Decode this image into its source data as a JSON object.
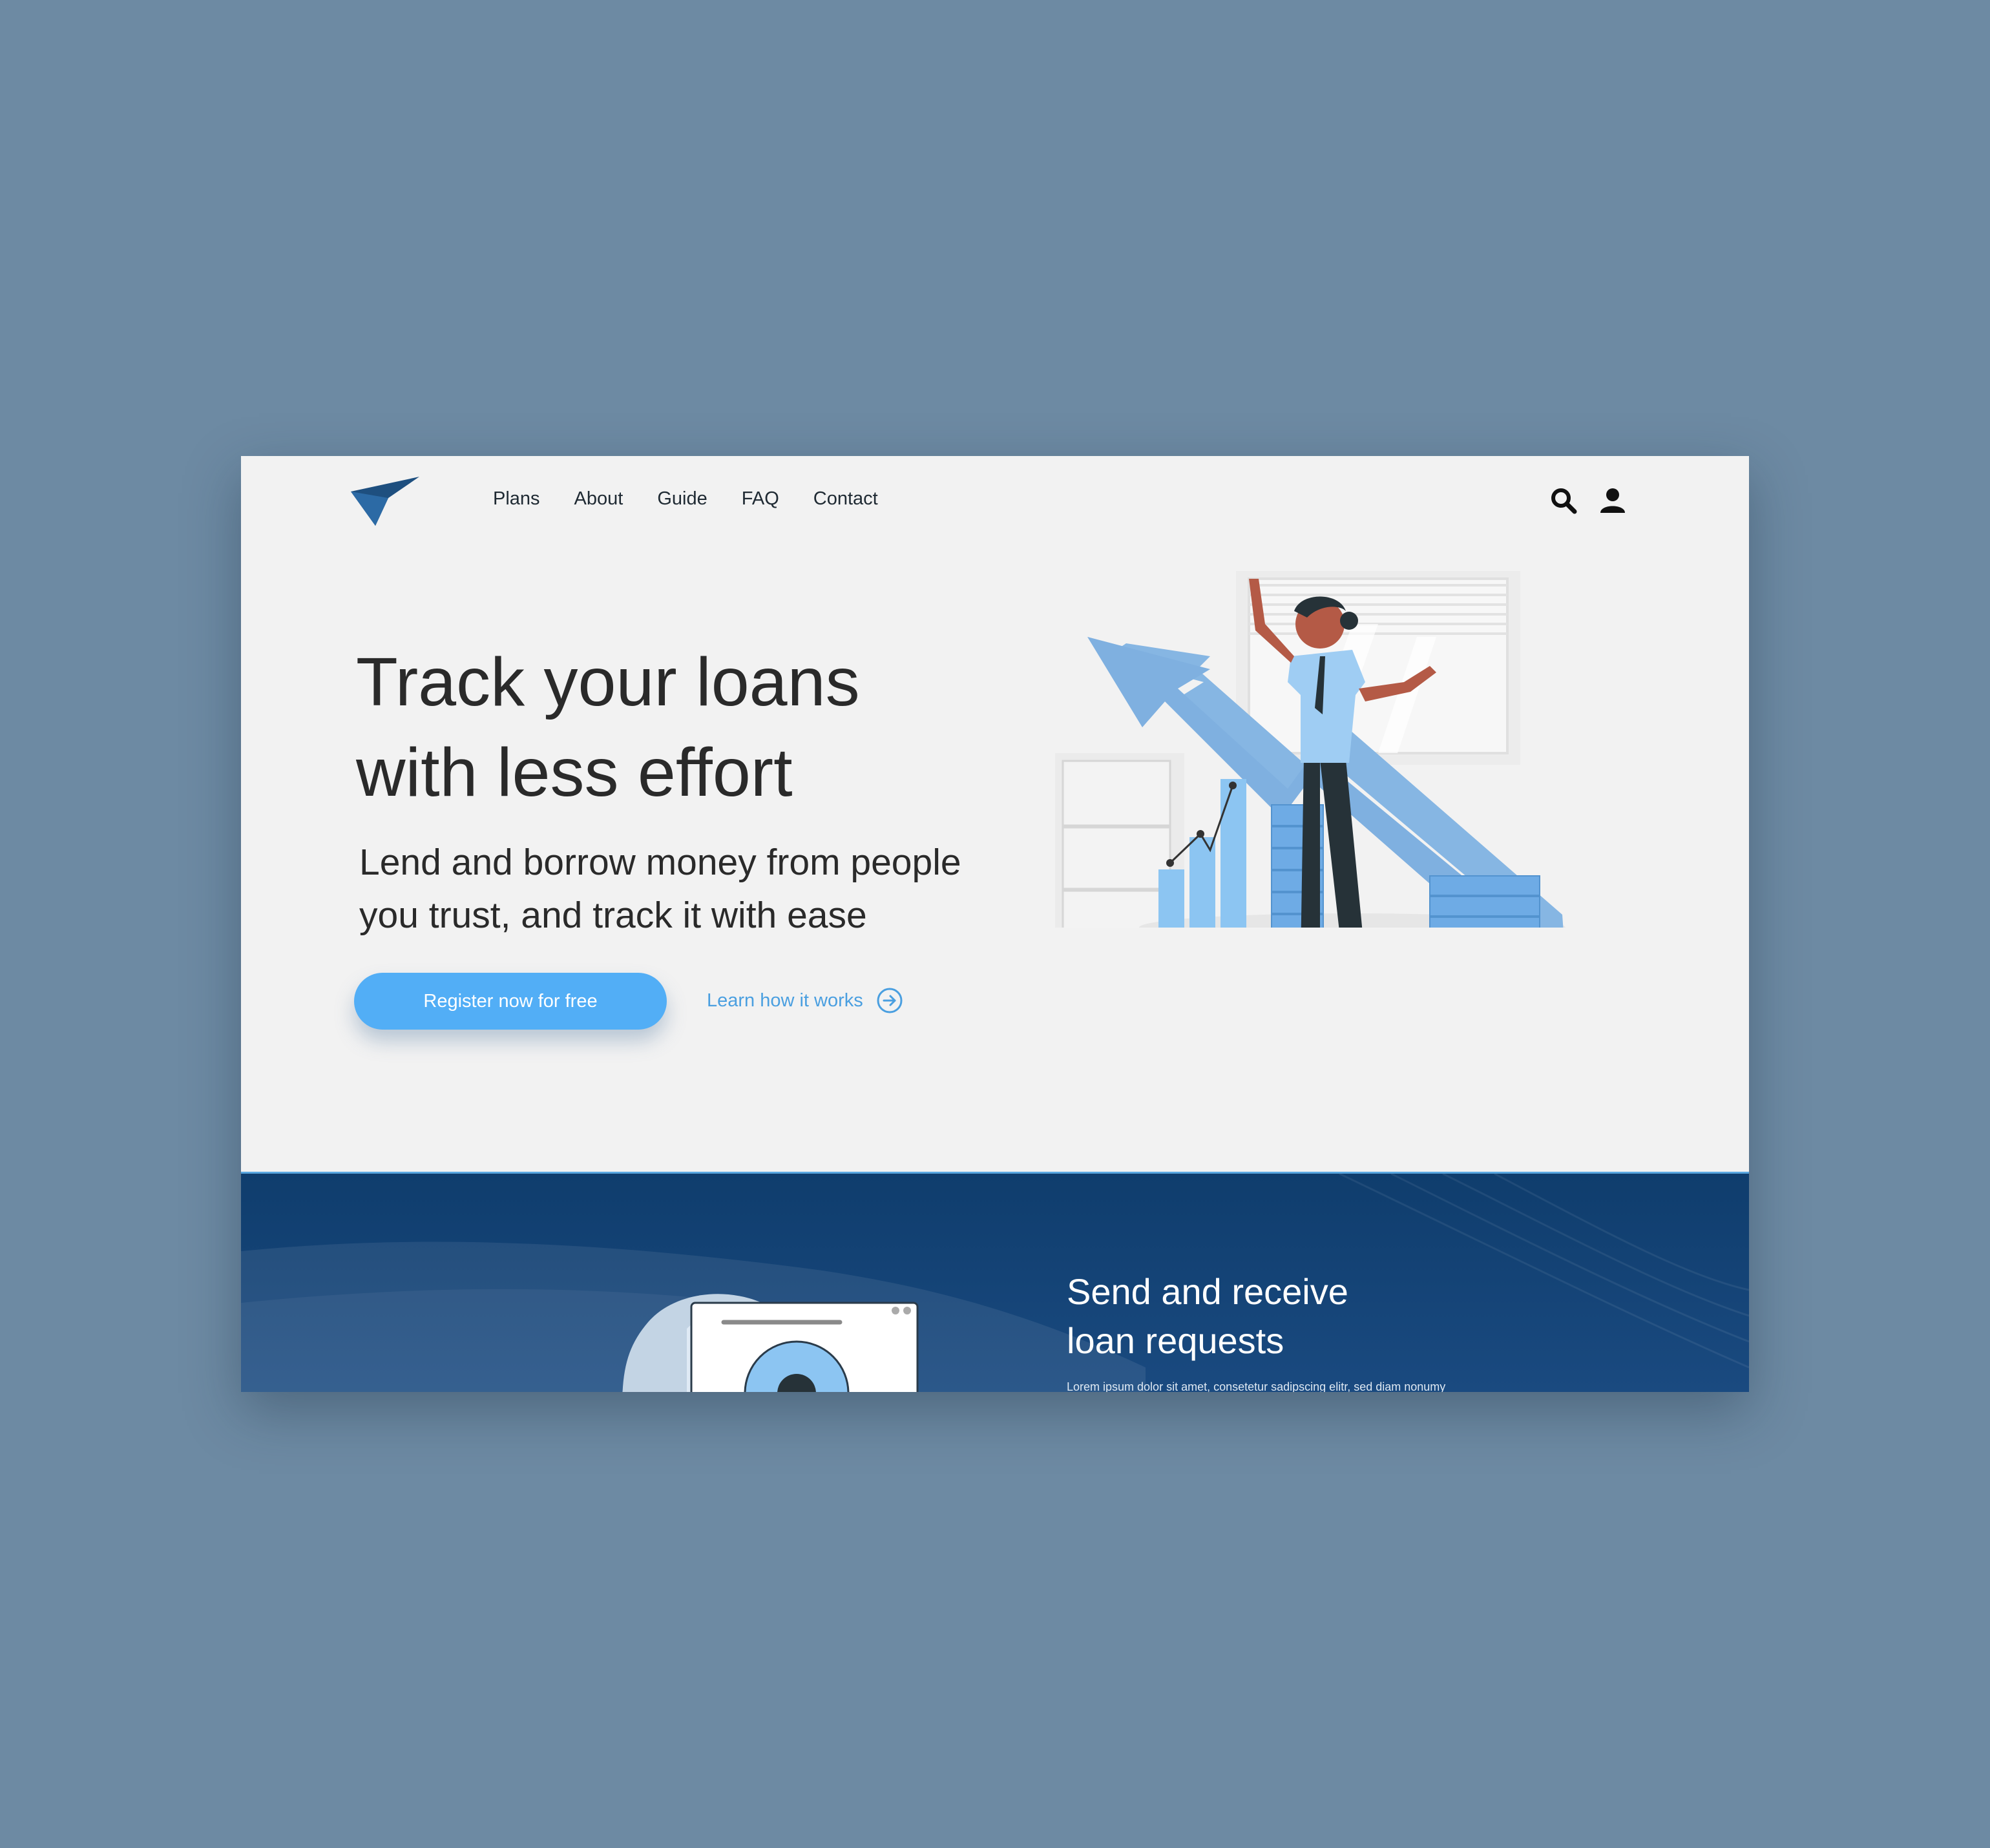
{
  "nav": {
    "links": [
      "Plans",
      "About",
      "Guide",
      "FAQ",
      "Contact"
    ],
    "icons": [
      "search-icon",
      "user-icon"
    ]
  },
  "hero": {
    "title_line1": "Track your loans",
    "title_line2": "with less effort",
    "subtitle_line1": "Lend and borrow money from people",
    "subtitle_line2": "you trust, and track it with ease",
    "cta_label": "Register now for free",
    "learn_label": "Learn how it works"
  },
  "section": {
    "title_line1": "Send and receive",
    "title_line2": "loan requests",
    "body": "Lorem ipsum dolor sit amet, consetetur sadipscing elitr, sed diam nonumy"
  },
  "colors": {
    "page_bg": "#6d8aa3",
    "hero_bg": "#f2f2f2",
    "accent": "#52aef6",
    "brand_dark": "#1e4f7f",
    "section_bg": "#0f3d6d"
  }
}
